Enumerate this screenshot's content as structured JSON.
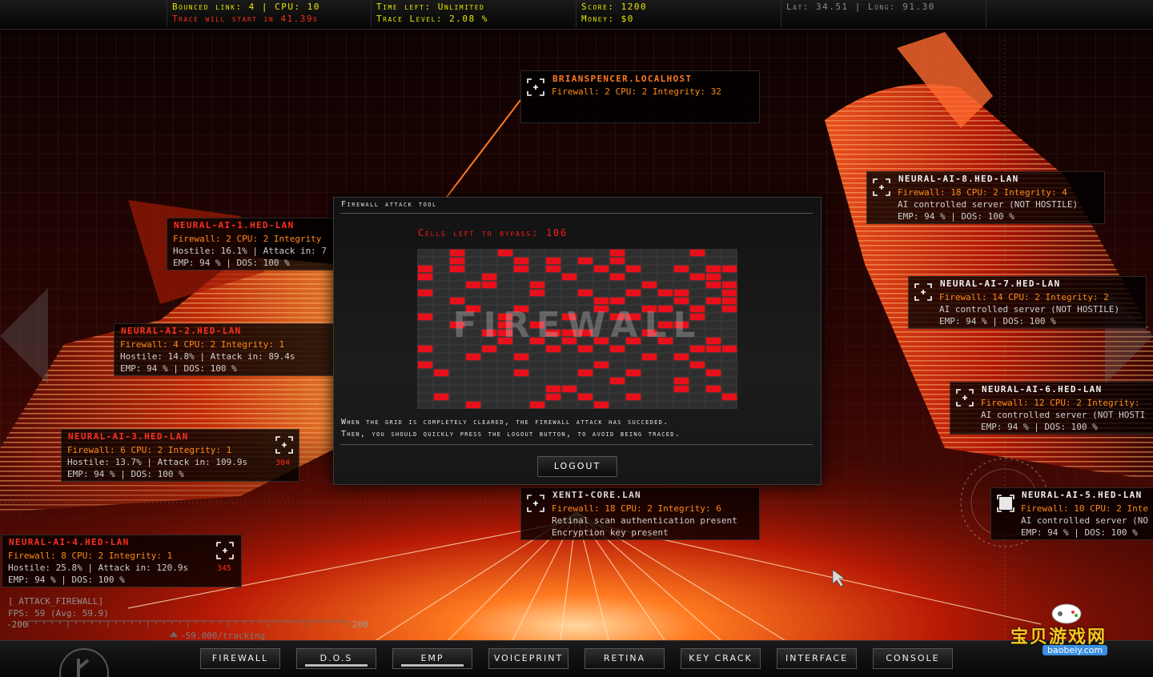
{
  "hud": {
    "bounced_link": "Bounced link: 4 | CPU: 10",
    "trace_warning": "Trace will start in 41.39s",
    "time_left": "Time left: Unlimited",
    "trace_level": "Trace Level: 2.08 %",
    "score": "Score: 1200",
    "money": "Money: $0",
    "coords": "Lat: 34.51  |  Long: 91.30"
  },
  "nodes": [
    {
      "id": "brianspencer",
      "name": "BRIANSPENCER.LOCALHOST",
      "stats": "Firewall: 2 CPU: 2 Integrity: 32",
      "lines": [],
      "num": ""
    },
    {
      "id": "neural1",
      "name": "NEURAL-AI-1.HED-LAN",
      "stats": "Firewall: 2 CPU: 2 Integrity",
      "lines": [
        "Hostile: 16.1% | Attack in: 7",
        "EMP:  94 % | DOS: 100 %"
      ],
      "num": ""
    },
    {
      "id": "neural2",
      "name": "NEURAL-AI-2.HED-LAN",
      "stats": "Firewall: 4 CPU: 2 Integrity: 1",
      "lines": [
        "Hostile: 14.8% | Attack in: 89.4s",
        "EMP:  94 % | DOS: 100 %"
      ],
      "num": ""
    },
    {
      "id": "neural3",
      "name": "NEURAL-AI-3.HED-LAN",
      "stats": "Firewall: 6 CPU: 2 Integrity: 1",
      "lines": [
        "Hostile: 13.7% | Attack in: 109.9s",
        "EMP:  94 % | DOS: 100 %"
      ],
      "num": "304"
    },
    {
      "id": "neural4",
      "name": "NEURAL-AI-4.HED-LAN",
      "stats": "Firewall: 8 CPU: 2 Integrity: 1",
      "lines": [
        "Hostile: 25.8% | Attack in: 120.9s",
        "EMP:  94 % | DOS: 100 %"
      ],
      "num": "345"
    },
    {
      "id": "neural8",
      "name": "NEURAL-AI-8.HED-LAN",
      "stats": "Firewall: 18 CPU: 2 Integrity: 4",
      "lines": [
        "AI controlled server (NOT HOSTILE)",
        "EMP:  94 % | DOS: 100 %"
      ],
      "num": ""
    },
    {
      "id": "neural7",
      "name": "NEURAL-AI-7.HED-LAN",
      "stats": "Firewall: 14 CPU: 2 Integrity: 2",
      "lines": [
        "AI controlled server (NOT HOSTILE)",
        "EMP:  94 % | DOS: 100 %"
      ],
      "num": ""
    },
    {
      "id": "neural6",
      "name": "NEURAL-AI-6.HED-LAN",
      "stats": "Firewall: 12 CPU: 2 Integrity:",
      "lines": [
        "AI controlled server (NOT HOSTI",
        "EMP:  94 % | DOS: 100 %"
      ],
      "num": ""
    },
    {
      "id": "xenti",
      "name": "XENTI-CORE.LAN",
      "stats": "Firewall: 18 CPU: 2 Integrity: 6",
      "lines": [
        "Retinal scan authentication present",
        "Encryption key present"
      ],
      "num": ""
    },
    {
      "id": "neural5",
      "name": "NEURAL-AI-5.HED-LAN",
      "stats": "Firewall: 10 CPU: 2 Inte",
      "lines": [
        "AI controlled server (NO",
        "EMP:  94 % | DOS: 100 %"
      ],
      "num": ""
    }
  ],
  "modal": {
    "title": "Firewall attack tool",
    "cells_left": "Cells left to bypass: 106",
    "grid_label": "FIREWALL",
    "grid": {
      "cols": 20,
      "rows": 20,
      "active": [
        [
          0,
          2
        ],
        [
          0,
          5
        ],
        [
          0,
          12
        ],
        [
          0,
          17
        ],
        [
          1,
          2
        ],
        [
          1,
          6
        ],
        [
          1,
          8
        ],
        [
          1,
          10
        ],
        [
          1,
          12
        ],
        [
          2,
          0
        ],
        [
          2,
          2
        ],
        [
          2,
          6
        ],
        [
          2,
          8
        ],
        [
          2,
          11
        ],
        [
          2,
          13
        ],
        [
          2,
          16
        ],
        [
          2,
          18
        ],
        [
          2,
          19
        ],
        [
          3,
          0
        ],
        [
          3,
          4
        ],
        [
          3,
          9
        ],
        [
          3,
          12
        ],
        [
          3,
          17
        ],
        [
          3,
          18
        ],
        [
          4,
          3
        ],
        [
          4,
          4
        ],
        [
          4,
          7
        ],
        [
          4,
          14
        ],
        [
          4,
          18
        ],
        [
          4,
          19
        ],
        [
          5,
          0
        ],
        [
          5,
          7
        ],
        [
          5,
          10
        ],
        [
          5,
          13
        ],
        [
          5,
          15
        ],
        [
          5,
          16
        ],
        [
          5,
          19
        ],
        [
          6,
          2
        ],
        [
          6,
          11
        ],
        [
          6,
          12
        ],
        [
          6,
          16
        ],
        [
          6,
          18
        ],
        [
          6,
          19
        ],
        [
          7,
          3
        ],
        [
          7,
          6
        ],
        [
          7,
          11
        ],
        [
          7,
          14
        ],
        [
          7,
          15
        ],
        [
          7,
          17
        ],
        [
          7,
          19
        ],
        [
          8,
          0
        ],
        [
          8,
          5
        ],
        [
          8,
          9
        ],
        [
          8,
          12
        ],
        [
          8,
          13
        ],
        [
          8,
          17
        ],
        [
          9,
          2
        ],
        [
          9,
          5
        ],
        [
          9,
          7
        ],
        [
          9,
          15
        ],
        [
          9,
          16
        ],
        [
          10,
          4
        ],
        [
          10,
          5
        ],
        [
          10,
          8
        ],
        [
          10,
          9
        ],
        [
          10,
          10
        ],
        [
          10,
          14
        ],
        [
          11,
          5
        ],
        [
          11,
          7
        ],
        [
          11,
          9
        ],
        [
          11,
          11
        ],
        [
          11,
          13
        ],
        [
          11,
          15
        ],
        [
          11,
          18
        ],
        [
          12,
          0
        ],
        [
          12,
          4
        ],
        [
          12,
          8
        ],
        [
          12,
          10
        ],
        [
          12,
          12
        ],
        [
          12,
          17
        ],
        [
          12,
          18
        ],
        [
          12,
          19
        ],
        [
          13,
          3
        ],
        [
          13,
          6
        ],
        [
          13,
          14
        ],
        [
          13,
          16
        ],
        [
          14,
          0
        ],
        [
          14,
          11
        ],
        [
          14,
          17
        ],
        [
          15,
          1
        ],
        [
          15,
          6
        ],
        [
          15,
          10
        ],
        [
          15,
          13
        ],
        [
          15,
          18
        ],
        [
          16,
          12
        ],
        [
          16,
          16
        ],
        [
          17,
          8
        ],
        [
          17,
          9
        ],
        [
          17,
          16
        ],
        [
          17,
          18
        ],
        [
          18,
          1
        ],
        [
          18,
          8
        ],
        [
          18,
          10
        ],
        [
          18,
          13
        ],
        [
          18,
          19
        ],
        [
          19,
          3
        ],
        [
          19,
          7
        ],
        [
          19,
          11
        ]
      ]
    },
    "msg1": "When the grid is completely cleared, the firewall attack has succeded.",
    "msg2": "Then, you should quickly press the logout button, to avoid being traced.",
    "logout": "LOGOUT"
  },
  "debug": {
    "tag": "[ ATTACK_FIREWALL]",
    "fps": "FPS:  59 (Avg: 59.9)",
    "scale_left": "-200",
    "scale_right": "200",
    "tracking": "-59.000/tracking"
  },
  "toolbar": [
    {
      "label": "FIREWALL",
      "underline": false
    },
    {
      "label": "D.O.S",
      "underline": true
    },
    {
      "label": "EMP",
      "underline": true
    },
    {
      "label": "VOICEPRINT",
      "underline": false
    },
    {
      "label": "RETINA",
      "underline": false
    },
    {
      "label": "KEY CRACK",
      "underline": false
    },
    {
      "label": "INTERFACE",
      "underline": false
    },
    {
      "label": "CONSOLE",
      "underline": false
    }
  ],
  "watermark": {
    "text": "宝贝游戏网",
    "url": "baobeiy.com"
  },
  "colors": {
    "accent_red": "#ff2a1a",
    "hud_yellow": "#e6e600",
    "stats_orange": "#ff8a1a",
    "node_name_red": "#ff3020",
    "node_name_white": "#f0f0f0"
  }
}
